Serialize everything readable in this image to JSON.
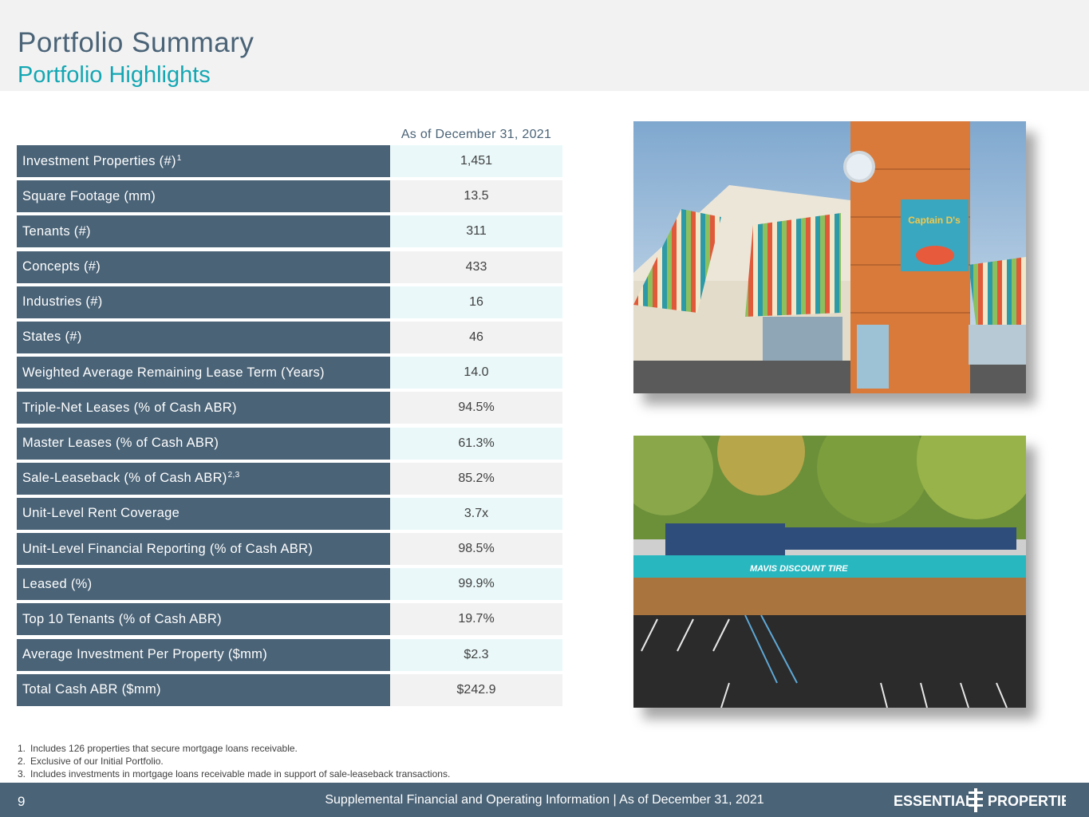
{
  "header": {
    "title": "Portfolio Summary",
    "subtitle": "Portfolio Highlights"
  },
  "table": {
    "column_header": "As of December 31, 2021",
    "rows": [
      {
        "label": "Investment Properties (#)",
        "sup": "1",
        "value": "1,451"
      },
      {
        "label": "Square Footage (mm)",
        "sup": "",
        "value": "13.5"
      },
      {
        "label": "Tenants (#)",
        "sup": "",
        "value": "311"
      },
      {
        "label": "Concepts (#)",
        "sup": "",
        "value": "433"
      },
      {
        "label": "Industries (#)",
        "sup": "",
        "value": "16"
      },
      {
        "label": "States (#)",
        "sup": "",
        "value": "46"
      },
      {
        "label": "Weighted Average Remaining Lease Term (Years)",
        "sup": "",
        "value": "14.0"
      },
      {
        "label": "Triple-Net Leases (% of Cash ABR)",
        "sup": "",
        "value": "94.5%"
      },
      {
        "label": "Master Leases (% of Cash ABR)",
        "sup": "",
        "value": "61.3%"
      },
      {
        "label": "Sale-Leaseback (% of Cash ABR)",
        "sup": "2,3",
        "value": "85.2%"
      },
      {
        "label": "Unit-Level Rent Coverage",
        "sup": "",
        "value": "3.7x"
      },
      {
        "label": "Unit-Level Financial Reporting (% of Cash ABR)",
        "sup": "",
        "value": "98.5%"
      },
      {
        "label": "Leased (%)",
        "sup": "",
        "value": "99.9%"
      },
      {
        "label": "Top 10 Tenants (% of Cash ABR)",
        "sup": "",
        "value": "19.7%"
      },
      {
        "label": "Average Investment Per Property ($mm)",
        "sup": "",
        "value": "$2.3"
      },
      {
        "label": "Total Cash ABR ($mm)",
        "sup": "",
        "value": "$242.9"
      }
    ]
  },
  "photos": {
    "restaurant_sign": "Captain D's",
    "tire_sign": "MAVIS DISCOUNT TIRE"
  },
  "footnotes": [
    {
      "num": "1.",
      "text": "Includes 126 properties that secure mortgage loans receivable."
    },
    {
      "num": "2.",
      "text": "Exclusive of our Initial Portfolio."
    },
    {
      "num": "3.",
      "text": "Includes investments in mortgage loans receivable made in support of sale-leaseback transactions."
    }
  ],
  "footer": {
    "page_number": "9",
    "text": "Supplemental Financial and Operating Information |  As of December 31, 2021",
    "logo_left": "ESSENTIAL",
    "logo_right": "PROPERTIES"
  },
  "colors": {
    "slate": "#4a6377",
    "teal": "#13a7b3",
    "light_teal": "#eaf8f9",
    "light_gray": "#f2f2f2"
  }
}
